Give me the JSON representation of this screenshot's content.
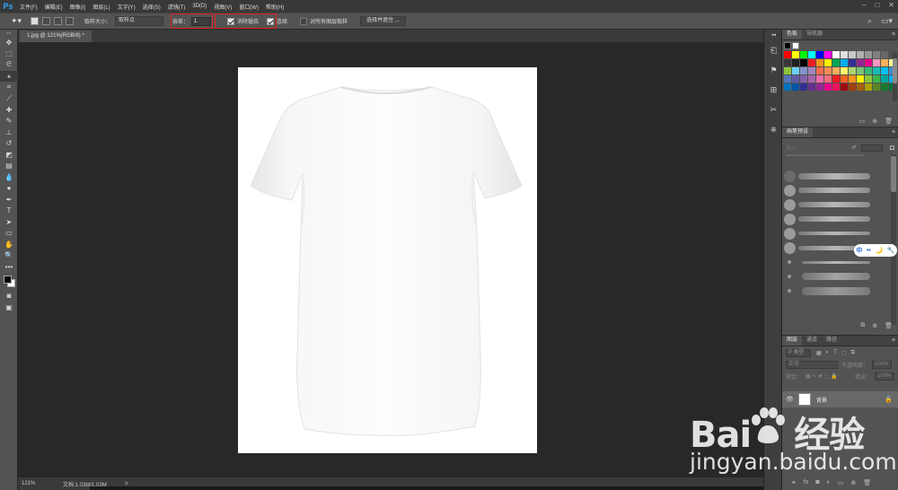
{
  "app": {
    "logo": "Ps"
  },
  "menu": [
    "文件(F)",
    "编辑(E)",
    "图像(I)",
    "图层(L)",
    "文字(Y)",
    "选择(S)",
    "滤镜(T)",
    "3D(D)",
    "视图(V)",
    "窗口(W)",
    "帮助(H)"
  ],
  "window_controls": [
    "–",
    "□",
    "✕"
  ],
  "options": {
    "sample_size_label": "取样大小：",
    "sample_size_value": "取样点",
    "tolerance_label": "容差：",
    "tolerance_value": "1",
    "antialias_label": "消除锯齿",
    "contiguous_label": "连续",
    "sample_all_label": "对所有图层取样",
    "select_mask_label": "选择并遮住 ..."
  },
  "document": {
    "tab_title": "1.jpg @ 121%(RGB/8) *",
    "zoom": "121%",
    "doc_info": "文档:1.03M/1.03M",
    "arrow": ">"
  },
  "panels": {
    "swatches_tab": "色板",
    "navigator_tab": "导航器",
    "brush_presets_tab": "画笔预设",
    "brush_size_label": "大小：",
    "layers_tab": "图层",
    "channels_tab": "通道",
    "paths_tab": "路径",
    "layer_kind": "P 类型",
    "blend_mode": "正常",
    "opacity_label": "不透明度：",
    "opacity_value": "100%",
    "lock_label": "锁定：",
    "fill_label": "填充：",
    "fill_value": "100%",
    "layer_name": "背景"
  },
  "swatch_colors": [
    "#ff0000",
    "#ffff00",
    "#00ff00",
    "#00ffff",
    "#0000ff",
    "#ff00ff",
    "#ffffff",
    "#e0e0e0",
    "#c8c8c8",
    "#b0b0b0",
    "#989898",
    "#808080",
    "#686868",
    "#505050",
    "#383838",
    "#202020",
    "#000000",
    "#ee1d24",
    "#f7941d",
    "#fff200",
    "#00a651",
    "#00aeef",
    "#2e3192",
    "#92278f",
    "#ec008c",
    "#f49ac1",
    "#fbaf5d",
    "#fff799",
    "#8dc63f",
    "#6dcff6",
    "#8393ca",
    "#a186be",
    "#f26c4f",
    "#f68e55",
    "#fbaf5c",
    "#fff467",
    "#acd372",
    "#7cc576",
    "#3bb878",
    "#1abbb4",
    "#00bff3",
    "#438ccb",
    "#5574b9",
    "#605ca8",
    "#855fa8",
    "#a763a9",
    "#f06ea9",
    "#f26d7d",
    "#ed1c24",
    "#f26522",
    "#f7941d",
    "#fff200",
    "#8dc63f",
    "#39b54a",
    "#00a99d",
    "#00aeef",
    "#0072bc",
    "#0054a6",
    "#2e3192",
    "#662d91",
    "#92278f",
    "#ec008c",
    "#ed145b",
    "#9e0b0f",
    "#a0410d",
    "#a36209",
    "#aba000",
    "#598527",
    "#1a7b30",
    "#007236"
  ],
  "colors": {
    "background": "#282828",
    "panel": "#535353",
    "highlight_box": "#e02020",
    "canvas": "#ffffff",
    "ps_blue": "#31a8ff"
  },
  "widget": [
    "中",
    "••",
    "🌙",
    "🔧"
  ],
  "watermark": {
    "logo_left": "Bai",
    "logo_right": "经验",
    "url": "jingyan.baidu.com"
  }
}
